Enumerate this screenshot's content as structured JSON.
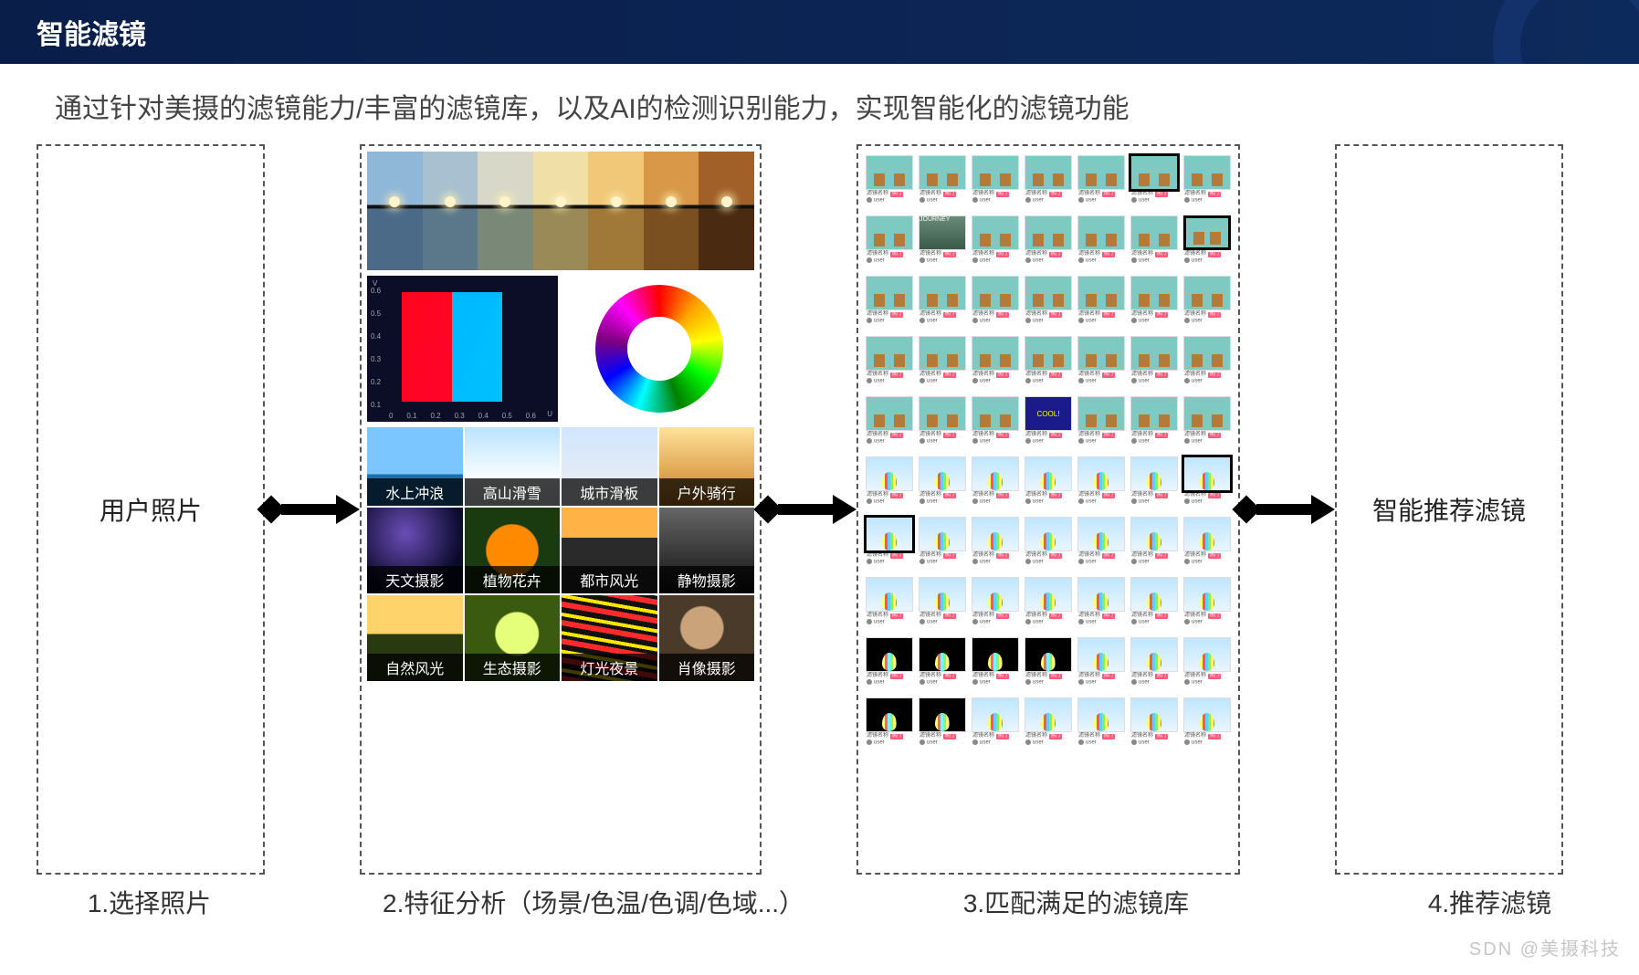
{
  "header": {
    "title": "智能滤镜"
  },
  "subtitle": "通过针对美摄的滤镜能力/丰富的滤镜库，以及AI的检测识别能力，实现智能化的滤镜功能",
  "box1": {
    "center_text": "用户照片"
  },
  "box4": {
    "center_text": "智能推荐滤镜"
  },
  "captions": {
    "c1": "1.选择照片",
    "c2": "2.特征分析（场景/色温/色调/色域...）",
    "c3": "3.匹配满足的滤镜库",
    "c4": "4.推荐滤镜"
  },
  "gamut": {
    "v_label": "V",
    "u_label": "U",
    "x_ticks": [
      "0",
      "0.1",
      "0.2",
      "0.3",
      "0.4",
      "0.5",
      "0.6"
    ],
    "y_ticks": [
      "0.6",
      "0.5",
      "0.4",
      "0.3",
      "0.2",
      "0.1"
    ]
  },
  "scene_rows": [
    [
      "水上冲浪",
      "高山滑雪",
      "城市滑板",
      "户外骑行"
    ],
    [
      "天文摄影",
      "植物花卉",
      "都市风光",
      "静物摄影"
    ],
    [
      "自然风光",
      "生态摄影",
      "灯光夜景",
      "肖像摄影"
    ]
  ],
  "watermark": "SDN @美摄科技",
  "filter_cols": 7,
  "filter_rows_furn": 5,
  "filter_rows_balloon_light": 3,
  "filter_rows_balloon_dark": 2,
  "journey_label": "JOURNEY",
  "cool_label": "COOL!",
  "tag_label": "热门",
  "thumb_meta_line": "滤镜名称"
}
